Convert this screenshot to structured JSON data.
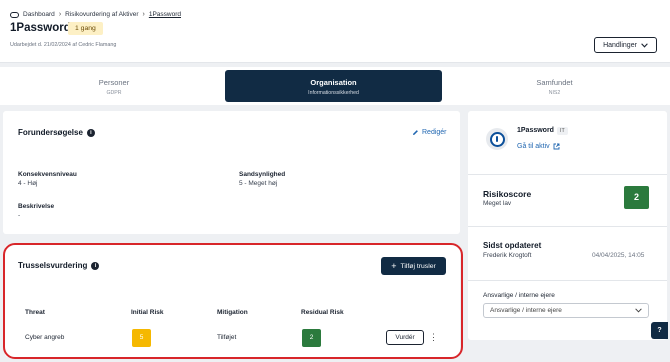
{
  "breadcrumb": {
    "home": "Dashboard",
    "parent": "Risikovurdering af Aktiver",
    "current": "1Password"
  },
  "page": {
    "title": "1Password",
    "frequency_badge": "1 gang",
    "subtitle": "Udarbejdet d. 21/02/2024 af Cedric Flamang",
    "actions_label": "Handlinger"
  },
  "tabs": [
    {
      "label": "Personer",
      "sub": "GDPR",
      "active": false
    },
    {
      "label": "Organisation",
      "sub": "Informationssikkerhed",
      "active": true
    },
    {
      "label": "Samfundet",
      "sub": "NIS2",
      "active": false
    }
  ],
  "preliminary": {
    "title": "Forundersøgelse",
    "edit_label": "Redigér",
    "consequence_label": "Konsekvensniveau",
    "consequence_value": "4 - Høj",
    "probability_label": "Sandsynlighed",
    "probability_value": "5 - Meget høj",
    "description_label": "Beskrivelse",
    "description_value": "-"
  },
  "threats": {
    "title": "Trusselsvurdering",
    "add_label": "Tilføj trusler",
    "headers": {
      "threat": "Threat",
      "initial": "Initial Risk",
      "mitigation": "Mitigation",
      "residual": "Residual Risk"
    },
    "rows": [
      {
        "threat": "Cyber angreb",
        "initial": "5",
        "mitigation": "Tilføjet",
        "residual": "2",
        "action": "Vurdér"
      }
    ]
  },
  "asset": {
    "name": "1Password",
    "tag": "IT",
    "link_label": "Gå til aktiv",
    "risk_score_label": "Risikoscore",
    "risk_score_level": "Meget lav",
    "risk_score": "2",
    "updated_label": "Sidst opdateret",
    "updated_by": "Frederik Krogtoft",
    "updated_at": "04/04/2025, 14:05",
    "owners_label": "Ansvarlige / interne ejere",
    "owners_placeholder": "Ansvarlige / interne ejere"
  },
  "colors": {
    "primary": "#112b44",
    "accent_link": "#2167b1",
    "risk_high": "#f5b800",
    "risk_low": "#2b7a3d",
    "highlight": "#d8262a"
  }
}
